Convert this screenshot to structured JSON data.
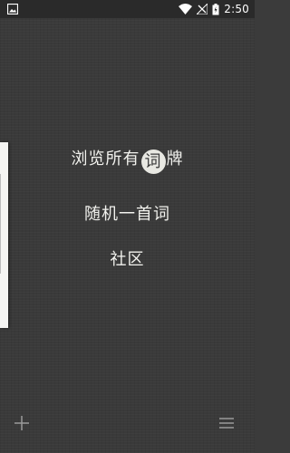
{
  "status_bar": {
    "time": "2:50",
    "icons": [
      "image-notification-icon",
      "wifi-icon",
      "signal-off-icon",
      "battery-charging-icon"
    ]
  },
  "menu": {
    "browse": {
      "prefix": "浏览所有",
      "highlight": "词",
      "suffix": "牌"
    },
    "random": "随机一首词",
    "community": "社区"
  },
  "toolbar": {
    "add_icon": "plus-icon",
    "menu_icon": "hamburger-menu-icon"
  },
  "colors": {
    "background": "#3a3a3a",
    "text": "#f2f2ee",
    "highlight_circle": "#e8e8e2",
    "side_panel": "#f4f4f2"
  }
}
